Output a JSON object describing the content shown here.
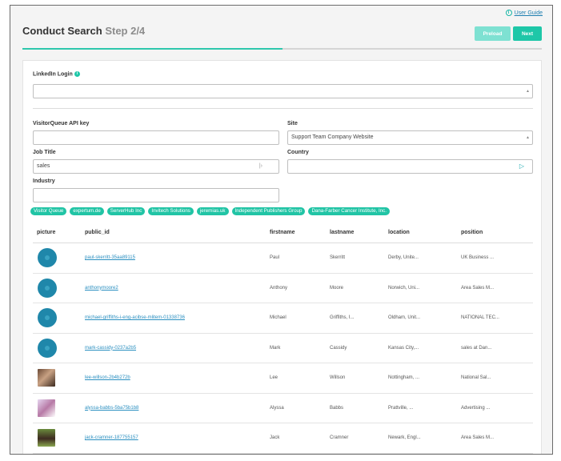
{
  "header": {
    "guide_label": "User Guide",
    "title": "Conduct Search",
    "step": "Step 2/4",
    "preload_label": "Preload",
    "next_label": "Next",
    "progress": 0.5
  },
  "form": {
    "linkedin_label": "LinkedIn Login",
    "linkedin_value": "",
    "api_key_label": "VisitorQueue API key",
    "api_key_value": "",
    "site_label": "Site",
    "site_value": "Support Team Company Website",
    "job_title_label": "Job Title",
    "job_title_value": "sales",
    "country_label": "Country",
    "country_value": "",
    "industry_label": "Industry",
    "industry_value": ""
  },
  "tags": [
    "Visitor Queue",
    "expertum.de",
    "ServerHub Inc",
    "Invitech Solutions",
    "jeremias.uk",
    "Independent Publishers Group",
    "Dana-Farber Cancer Institute, Inc."
  ],
  "table": {
    "columns": [
      "picture",
      "public_id",
      "firstname",
      "lastname",
      "location",
      "position"
    ],
    "rows": [
      {
        "avatar": "placeholder-avatar",
        "public_id": "paul-skerritt-35aa89115",
        "firstname": "Paul",
        "lastname": "Skerritt",
        "location": "Derby, Unite...",
        "position": "UK Business ..."
      },
      {
        "avatar": "placeholder-avatar",
        "public_id": "anthonymoore2",
        "firstname": "Anthony",
        "lastname": "Moore",
        "location": "Norwich, Uni...",
        "position": "Area Sales M..."
      },
      {
        "avatar": "placeholder-avatar",
        "public_id": "michael-griffiths-i-eng-acibse-mlitem-01338736",
        "firstname": "Michael",
        "lastname": "Griffiths, I...",
        "location": "Oldham, Unit...",
        "position": "NATIONAL TEC..."
      },
      {
        "avatar": "placeholder-avatar",
        "public_id": "mark-cassidy-0237a2b5",
        "firstname": "Mark",
        "lastname": "Cassidy",
        "location": "Kansas City,...",
        "position": "sales at Dan..."
      },
      {
        "avatar": "photo-1",
        "public_id": "lee-willson-2b4b272b",
        "firstname": "Lee",
        "lastname": "Willson",
        "location": "Nottingham, ...",
        "position": "National Sal..."
      },
      {
        "avatar": "photo-2",
        "public_id": "alyssa-babbs-5ba75b1b8",
        "firstname": "Alyssa",
        "lastname": "Babbs",
        "location": "Prattville, ...",
        "position": "Advertising ..."
      },
      {
        "avatar": "photo-3",
        "public_id": "jack-cramner-187755157",
        "firstname": "Jack",
        "lastname": "Cramner",
        "location": "Newark, Engl...",
        "position": "Area Sales M..."
      }
    ]
  }
}
